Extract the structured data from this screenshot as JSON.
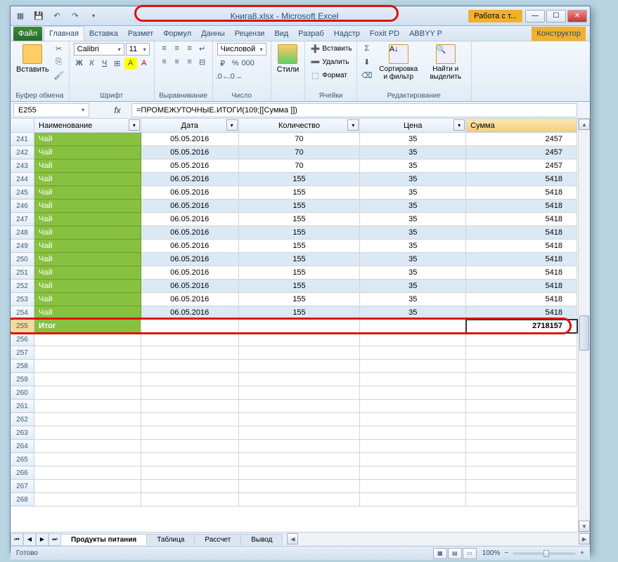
{
  "title": "Книга8.xlsx - Microsoft Excel",
  "table_tools": "Работа с т...",
  "tabs": {
    "file": "Файл",
    "home": "Главная",
    "insert": "Вставка",
    "pagelayout": "Размет",
    "formulas": "Формул",
    "data": "Данны",
    "review": "Рецензи",
    "view": "Вид",
    "developer": "Разраб",
    "addins": "Надстр",
    "foxit": "Foxit PD",
    "abbyy": "ABBYY P",
    "constructor": "Конструктор"
  },
  "ribbon": {
    "clipboard": {
      "paste": "Вставить",
      "label": "Буфер обмена"
    },
    "font": {
      "family": "Calibri",
      "size": "11",
      "label": "Шрифт"
    },
    "alignment": {
      "label": "Выравнивание"
    },
    "number": {
      "format": "Числовой",
      "label": "Число"
    },
    "styles": {
      "btn": "Стили",
      "label": ""
    },
    "cells": {
      "insert": "Вставить",
      "delete": "Удалить",
      "format": "Формат",
      "label": "Ячейки"
    },
    "editing": {
      "sort": "Сортировка и фильтр",
      "find": "Найти и выделить",
      "label": "Редактирование"
    }
  },
  "name_box": "E255",
  "formula": "=ПРОМЕЖУТОЧНЫЕ.ИТОГИ(109;[[Сумма ]])",
  "headers": [
    "Наименование",
    "Дата",
    "Количество",
    "Цена",
    "Сумма"
  ],
  "row_start": 241,
  "rows": [
    {
      "n": 241,
      "a": "Чай",
      "b": "05.05.2016",
      "c": "70",
      "d": "35",
      "e": "2457"
    },
    {
      "n": 242,
      "a": "Чай",
      "b": "05.05.2016",
      "c": "70",
      "d": "35",
      "e": "2457"
    },
    {
      "n": 243,
      "a": "Чай",
      "b": "05.05.2016",
      "c": "70",
      "d": "35",
      "e": "2457"
    },
    {
      "n": 244,
      "a": "Чай",
      "b": "06.05.2016",
      "c": "155",
      "d": "35",
      "e": "5418"
    },
    {
      "n": 245,
      "a": "Чай",
      "b": "06.05.2016",
      "c": "155",
      "d": "35",
      "e": "5418"
    },
    {
      "n": 246,
      "a": "Чай",
      "b": "06.05.2016",
      "c": "155",
      "d": "35",
      "e": "5418"
    },
    {
      "n": 247,
      "a": "Чай",
      "b": "06.05.2016",
      "c": "155",
      "d": "35",
      "e": "5418"
    },
    {
      "n": 248,
      "a": "Чай",
      "b": "06.05.2016",
      "c": "155",
      "d": "35",
      "e": "5418"
    },
    {
      "n": 249,
      "a": "Чай",
      "b": "06.05.2016",
      "c": "155",
      "d": "35",
      "e": "5418"
    },
    {
      "n": 250,
      "a": "Чай",
      "b": "06.05.2016",
      "c": "155",
      "d": "35",
      "e": "5418"
    },
    {
      "n": 251,
      "a": "Чай",
      "b": "06.05.2016",
      "c": "155",
      "d": "35",
      "e": "5418"
    },
    {
      "n": 252,
      "a": "Чай",
      "b": "06.05.2016",
      "c": "155",
      "d": "35",
      "e": "5418"
    },
    {
      "n": 253,
      "a": "Чай",
      "b": "06.05.2016",
      "c": "155",
      "d": "35",
      "e": "5418"
    },
    {
      "n": 254,
      "a": "Чай",
      "b": "06.05.2016",
      "c": "155",
      "d": "35",
      "e": "5418"
    }
  ],
  "total_row": {
    "n": 255,
    "a": "Итог",
    "b": "",
    "c": "",
    "d": "",
    "e": "2718157"
  },
  "empty_rows": [
    256,
    257,
    258,
    259,
    260,
    261,
    262,
    263,
    264,
    265,
    266,
    267,
    268
  ],
  "sheets": {
    "s1": "Продукты питания",
    "s2": "Таблица",
    "s3": "Рассчет",
    "s4": "Вывод"
  },
  "status": {
    "ready": "Готово",
    "zoom": "100%"
  }
}
